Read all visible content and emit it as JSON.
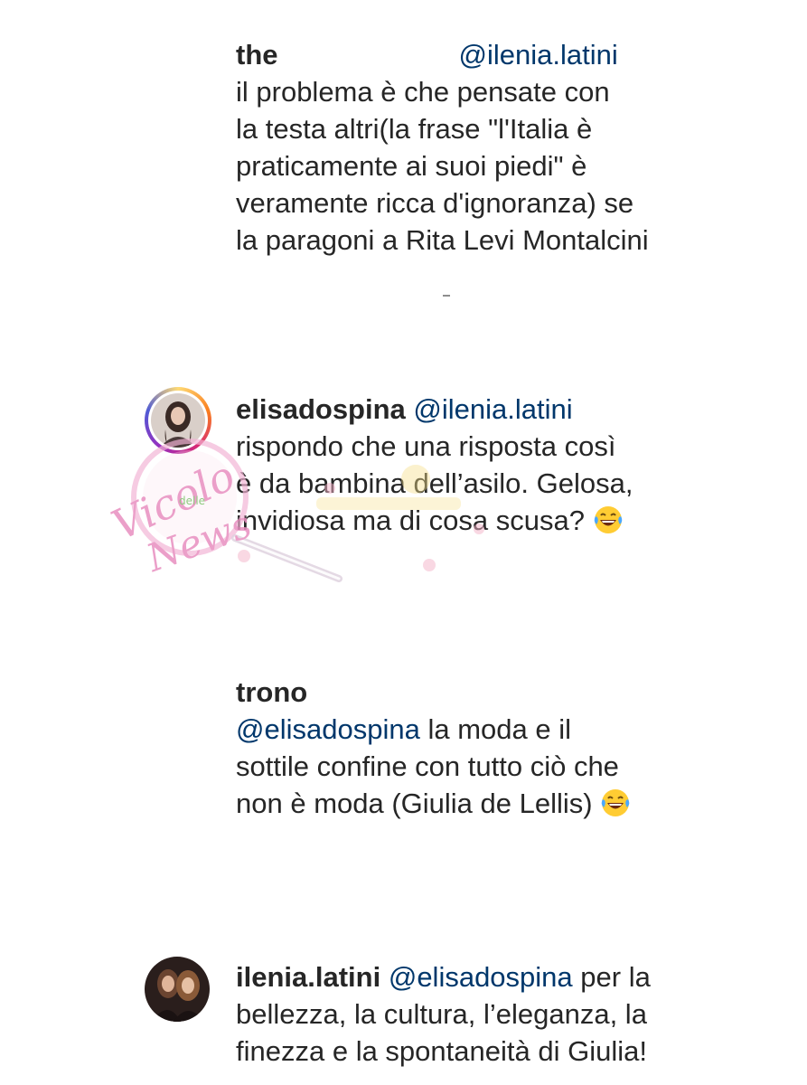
{
  "comments": [
    {
      "username": "the",
      "mention": "@ilenia.latini",
      "lines": [
        "il problema è che pensate con",
        "la testa altri(la frase \"l'Italia è",
        "praticamente ai suoi piedi\" è",
        "veramente ricca d'ignoranza) se",
        "la paragoni a Rita Levi Montalcini"
      ]
    },
    {
      "username": "elisadospina",
      "mention": "@ilenia.latini",
      "lines": [
        "rispondo che una risposta così",
        "è da bambina dell’asilo. Gelosa,",
        "invidiosa ma di cosa scusa?"
      ],
      "emoji": "face-with-tears-of-joy"
    },
    {
      "username": "trono",
      "mention": "@elisadospina",
      "text_after_mention": "la moda e il",
      "lines": [
        "sottile confine con tutto ciò che",
        "non è moda (Giulia de Lellis)"
      ],
      "emoji": "face-with-tears-of-joy"
    },
    {
      "username": "ilenia.latini",
      "mention": "@elisadospina",
      "text_after_mention": "per la",
      "lines": [
        "bellezza, la cultura, l’eleganza, la",
        "finezza e la spontaneità di Giulia!"
      ]
    }
  ],
  "watermark": {
    "line1": "Vicolo",
    "line2": "delle",
    "line3": "News"
  },
  "colors": {
    "text": "#262626",
    "mention": "#00376b",
    "watermark": "#e88fc0"
  }
}
